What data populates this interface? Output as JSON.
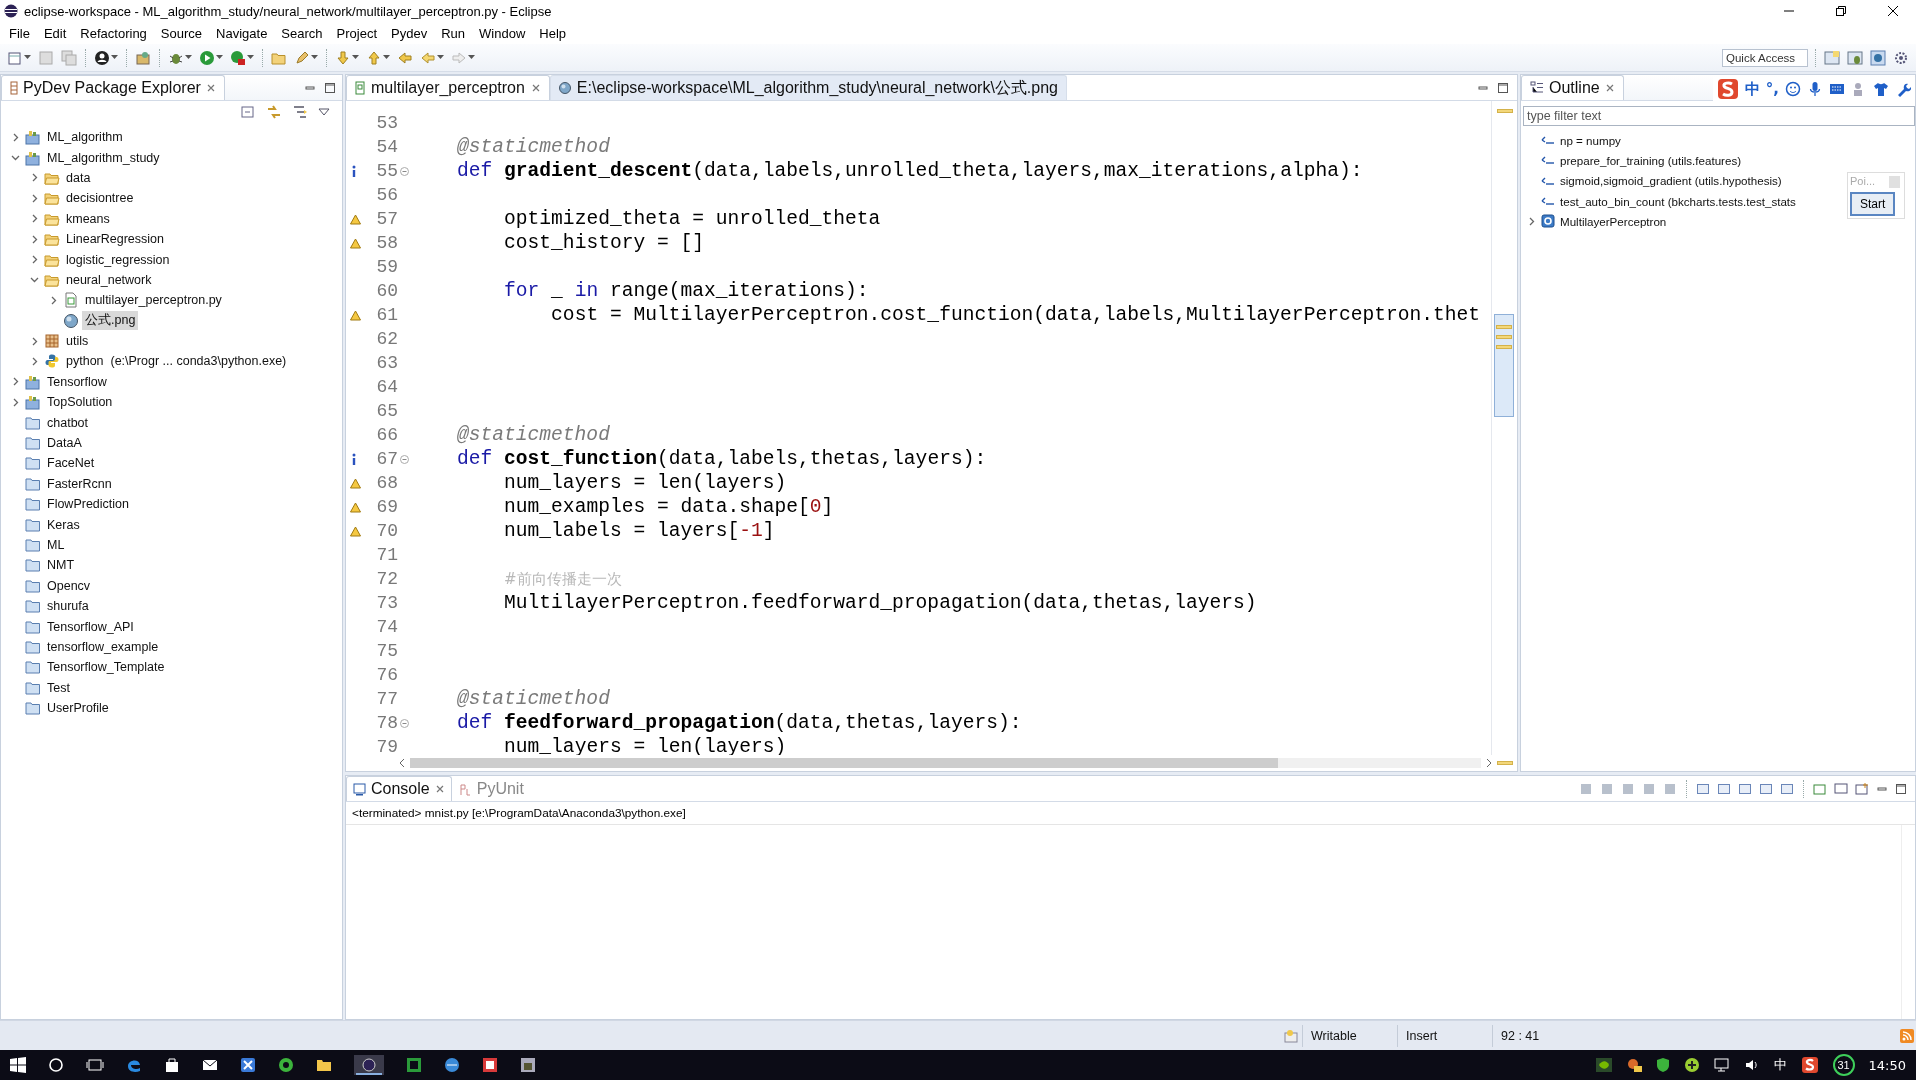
{
  "window": {
    "title": "eclipse-workspace - ML_algorithm_study/neural_network/multilayer_perceptron.py - Eclipse"
  },
  "menu": [
    "File",
    "Edit",
    "Refactoring",
    "Source",
    "Navigate",
    "Search",
    "Project",
    "Pydev",
    "Run",
    "Window",
    "Help"
  ],
  "toolbar": {
    "quick_access": {
      "placeholder": "Quick Access"
    }
  },
  "explorer": {
    "title": "PyDev Package Explorer",
    "items": [
      {
        "label": "ML_algorithm",
        "kind": "project",
        "expanded": false,
        "selected": false
      },
      {
        "label": "ML_algorithm_study",
        "kind": "project",
        "expanded": true,
        "selected": false,
        "children": [
          {
            "label": "data",
            "kind": "folder",
            "expanded": false,
            "selected": false
          },
          {
            "label": "decisiontree",
            "kind": "folder",
            "expanded": false,
            "selected": false
          },
          {
            "label": "kmeans",
            "kind": "folder",
            "expanded": false,
            "selected": false
          },
          {
            "label": "LinearRegression",
            "kind": "folder",
            "expanded": false,
            "selected": false
          },
          {
            "label": "logistic_regression",
            "kind": "folder",
            "expanded": false,
            "selected": false
          },
          {
            "label": "neural_network",
            "kind": "folder",
            "expanded": true,
            "selected": false,
            "children": [
              {
                "label": "multilayer_perceptron.py",
                "kind": "pyfile",
                "expanded": false,
                "selected": false
              },
              {
                "label": "公式.png",
                "kind": "image",
                "selected": true
              }
            ]
          },
          {
            "label": "utils",
            "kind": "package",
            "expanded": false,
            "selected": false
          },
          {
            "label": "python  (e:\\Progr ... conda3\\python.exe)",
            "kind": "interpreter",
            "expanded": false,
            "selected": false
          }
        ]
      },
      {
        "label": "Tensorflow",
        "kind": "project",
        "expanded": false,
        "selected": false
      },
      {
        "label": "TopSolution",
        "kind": "project",
        "expanded": false,
        "selected": false
      },
      {
        "label": "chatbot",
        "kind": "closed",
        "selected": false
      },
      {
        "label": "DataA",
        "kind": "closed",
        "selected": false
      },
      {
        "label": "FaceNet",
        "kind": "closed",
        "selected": false
      },
      {
        "label": "FasterRcnn",
        "kind": "closed",
        "selected": false
      },
      {
        "label": "FlowPrediction",
        "kind": "closed",
        "selected": false
      },
      {
        "label": "Keras",
        "kind": "closed",
        "selected": false
      },
      {
        "label": "ML",
        "kind": "closed",
        "selected": false
      },
      {
        "label": "NMT",
        "kind": "closed",
        "selected": false
      },
      {
        "label": "Opencv",
        "kind": "closed",
        "selected": false
      },
      {
        "label": "shurufa",
        "kind": "closed",
        "selected": false
      },
      {
        "label": "Tensorflow_API",
        "kind": "closed",
        "selected": false
      },
      {
        "label": "tensorflow_example",
        "kind": "closed",
        "selected": false
      },
      {
        "label": "Tensorflow_Template",
        "kind": "closed",
        "selected": false
      },
      {
        "label": "Test",
        "kind": "closed",
        "selected": false
      },
      {
        "label": "UserProfile",
        "kind": "closed",
        "selected": false
      }
    ]
  },
  "editor": {
    "tabs": [
      {
        "label": "multilayer_perceptron",
        "kind": "python",
        "selected": true
      },
      {
        "label": "E:\\eclipse-workspace\\ML_algorithm_study\\neural_network\\公式.png",
        "kind": "image",
        "selected": false
      }
    ],
    "lines": [
      {
        "number": "53",
        "fold": false
      },
      {
        "number": "54",
        "fold": false,
        "tokens": [
          {
            "kind": "decorator",
            "text": "@staticmethod"
          }
        ]
      },
      {
        "number": "55",
        "annotation": {
          "kind": "info"
        },
        "fold": true,
        "tokens": [
          {
            "kind": "keyword",
            "text": "def "
          },
          {
            "kind": "function",
            "text": "gradient_descent"
          },
          {
            "kind": "plain",
            "text": "(data,labels,unrolled_theta,layers,max_iterations,alpha):"
          }
        ],
        "children": [
          {
            "number": "56",
            "fold": false
          },
          {
            "number": "57",
            "annotation": {
              "kind": "warning"
            },
            "fold": false,
            "tokens": [
              {
                "kind": "plain",
                "text": "optimized_theta = unrolled_theta"
              }
            ]
          },
          {
            "number": "58",
            "annotation": {
              "kind": "warning"
            },
            "fold": false,
            "tokens": [
              {
                "kind": "plain",
                "text": "cost_history = []"
              }
            ]
          },
          {
            "number": "59",
            "fold": false
          },
          {
            "number": "60",
            "fold": false,
            "tokens": [
              {
                "kind": "keyword",
                "text": "for"
              },
              {
                "kind": "plain",
                "text": " _ "
              },
              {
                "kind": "keyword",
                "text": "in"
              },
              {
                "kind": "plain",
                "text": " range(max_iterations):"
              }
            ],
            "children": [
              {
                "number": "61",
                "annotation": {
                  "kind": "warning"
                },
                "fold": false,
                "tokens": [
                  {
                    "kind": "plain",
                    "text": "cost = MultilayerPerceptron.cost_function(data,labels,MultilayerPerceptron.thet"
                  }
                ]
              },
              {
                "number": "62",
                "fold": false
              },
              {
                "number": "63",
                "fold": false
              },
              {
                "number": "64",
                "fold": false
              },
              {
                "number": "65",
                "fold": false
              }
            ]
          }
        ]
      },
      {
        "number": "66",
        "fold": false,
        "tokens": [
          {
            "kind": "decorator",
            "text": "@staticmethod"
          }
        ]
      },
      {
        "number": "67",
        "annotation": {
          "kind": "info"
        },
        "fold": true,
        "tokens": [
          {
            "kind": "keyword",
            "text": "def "
          },
          {
            "kind": "function",
            "text": "cost_function"
          },
          {
            "kind": "plain",
            "text": "(data,labels,thetas,layers):"
          }
        ],
        "children": [
          {
            "number": "68",
            "annotation": {
              "kind": "warning"
            },
            "fold": false,
            "tokens": [
              {
                "kind": "plain",
                "text": "num_layers = len(layers)"
              }
            ]
          },
          {
            "number": "69",
            "annotation": {
              "kind": "warning"
            },
            "fold": false,
            "tokens": [
              {
                "kind": "plain",
                "text": "num_examples = data.shape["
              },
              {
                "kind": "number",
                "text": "0"
              },
              {
                "kind": "plain",
                "text": "]"
              }
            ]
          },
          {
            "number": "70",
            "annotation": {
              "kind": "warning"
            },
            "fold": false,
            "tokens": [
              {
                "kind": "plain",
                "text": "num_labels = layers["
              },
              {
                "kind": "number",
                "text": "-1"
              },
              {
                "kind": "plain",
                "text": "]"
              }
            ]
          },
          {
            "number": "71",
            "fold": false
          },
          {
            "number": "72",
            "fold": false,
            "tokens": [
              {
                "kind": "comment",
                "text": "#前向传播走一次"
              }
            ]
          },
          {
            "number": "73",
            "fold": false,
            "tokens": [
              {
                "kind": "plain",
                "text": "MultilayerPerceptron.feedforward_propagation(data,thetas,layers)"
              }
            ]
          },
          {
            "number": "74",
            "fold": false
          },
          {
            "number": "75",
            "fold": false
          },
          {
            "number": "76",
            "fold": false
          }
        ]
      },
      {
        "number": "77",
        "fold": false,
        "tokens": [
          {
            "kind": "decorator",
            "text": "@staticmethod"
          }
        ]
      },
      {
        "number": "78",
        "fold": true,
        "tokens": [
          {
            "kind": "keyword",
            "text": "def "
          },
          {
            "kind": "function",
            "text": "feedforward_propagation"
          },
          {
            "kind": "plain",
            "text": "(data,thetas,layers):"
          }
        ],
        "children": [
          {
            "number": "79",
            "fold": false,
            "tokens": [
              {
                "kind": "plain",
                "text": "num_layers = len(layers)"
              }
            ]
          }
        ]
      }
    ]
  },
  "outline": {
    "title": "Outline",
    "filter": {
      "placeholder": "type filter text"
    },
    "items": [
      {
        "label": "np = numpy",
        "kind": "import",
        "selected": false
      },
      {
        "label": "prepare_for_training (utils.features)",
        "kind": "import",
        "selected": false
      },
      {
        "label": "sigmoid,sigmoid_gradient (utils.hypothesis)",
        "kind": "import",
        "selected": false
      },
      {
        "label": "test_auto_bin_count (bkcharts.tests.test_stats",
        "kind": "import",
        "selected": false
      },
      {
        "label": "MultilayerPerceptron",
        "kind": "class",
        "expanded": false,
        "selected": false
      }
    ],
    "popup": {
      "text": "Poi...",
      "button": "Start"
    }
  },
  "ime_bar": {
    "mode": "中",
    "punctuation": "°,"
  },
  "console": {
    "tabs": [
      {
        "label": "Console",
        "selected": true
      },
      {
        "label": "PyUnit",
        "selected": false
      }
    ],
    "output": "<terminated> mnist.py [e:\\ProgramData\\Anaconda3\\python.exe]"
  },
  "status_bar": {
    "mode": "Writable",
    "insert": "Insert",
    "position": "92 : 41"
  },
  "taskbar": {
    "input_method": "中",
    "badge": "31",
    "clock": "14:50"
  }
}
